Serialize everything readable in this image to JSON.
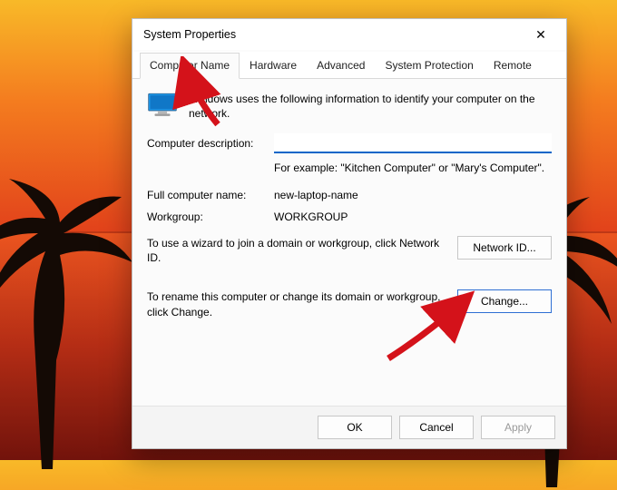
{
  "window": {
    "title": "System Properties"
  },
  "tabs": {
    "t0": "Computer Name",
    "t1": "Hardware",
    "t2": "Advanced",
    "t3": "System Protection",
    "t4": "Remote"
  },
  "intro": "Windows uses the following information to identify your computer on the network.",
  "labels": {
    "description": "Computer description:",
    "example": "For example: \"Kitchen Computer\" or \"Mary's Computer\".",
    "full_name": "Full computer name:",
    "workgroup": "Workgroup:"
  },
  "values": {
    "description": "",
    "full_name": "new-laptop-name",
    "workgroup": "WORKGROUP"
  },
  "sections": {
    "wizard": "To use a wizard to join a domain or workgroup, click Network ID.",
    "rename": "To rename this computer or change its domain or workgroup, click Change."
  },
  "buttons": {
    "network_id": "Network ID...",
    "change": "Change...",
    "ok": "OK",
    "cancel": "Cancel",
    "apply": "Apply"
  },
  "annotations": {
    "arrow1": "to-tab-computer-name",
    "arrow2": "to-change-button"
  }
}
